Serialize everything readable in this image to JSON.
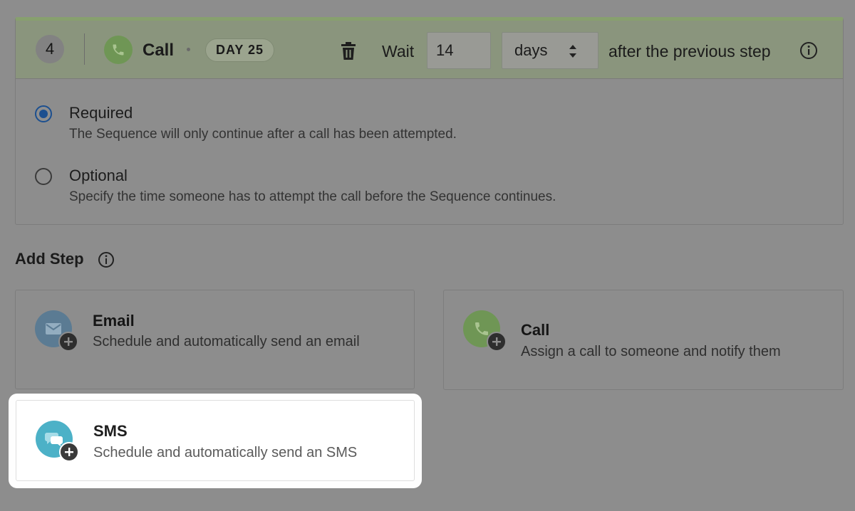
{
  "step": {
    "number": "4",
    "type_label": "Call",
    "day_badge": "DAY 25",
    "wait_label": "Wait",
    "wait_value": "14",
    "unit_value": "days",
    "after_text": "after the previous step",
    "options": [
      {
        "title": "Required",
        "description": "The Sequence will only continue after a call has been attempted.",
        "checked": true
      },
      {
        "title": "Optional",
        "description": "Specify the time someone has to attempt the call before the Sequence continues.",
        "checked": false
      }
    ]
  },
  "add_step": {
    "title": "Add Step",
    "cards": [
      {
        "title": "Email",
        "description": "Schedule and automatically send an email",
        "icon": "email-icon",
        "color": "#5b7b93"
      },
      {
        "title": "Call",
        "description": "Assign a call to someone and notify them",
        "icon": "phone-icon",
        "color": "#6f9655"
      },
      {
        "title": "SMS",
        "description": "Schedule and automatically send an SMS",
        "icon": "chat-bubble-icon",
        "color": "#4cb1c7"
      }
    ]
  },
  "colors": {
    "accent_green": "#87a06e",
    "radio_blue": "#1c4f8f",
    "overlay_gray": "#8d8d8d"
  }
}
